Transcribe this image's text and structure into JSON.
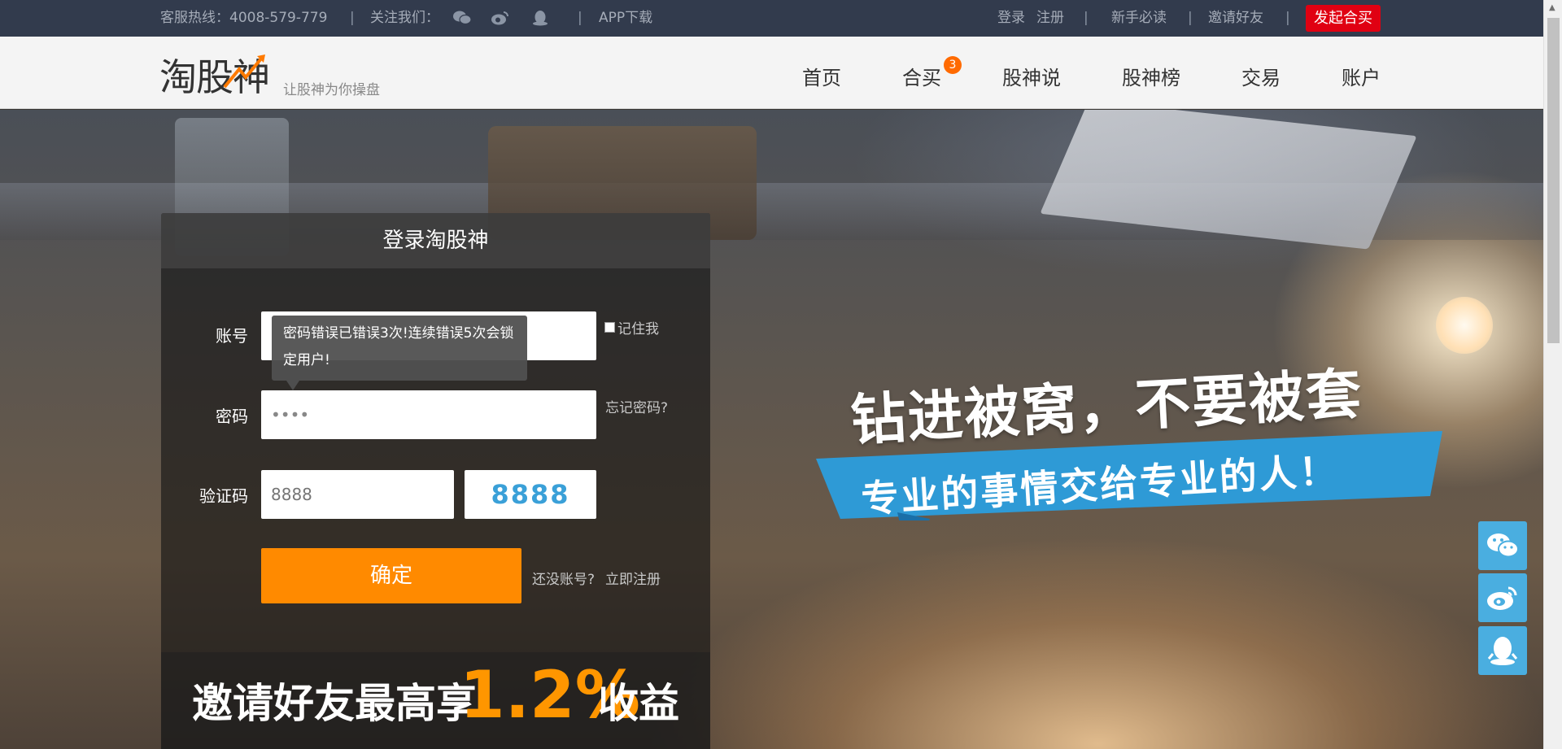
{
  "topbar": {
    "hotline": "客服热线：4008-579-779",
    "follow": "关注我们：",
    "app": "APP下载",
    "login": "登录",
    "register": "注册",
    "guide": "新手必读",
    "invite": "邀请好友",
    "launch": "发起合买",
    "separator": "|"
  },
  "header": {
    "logo": "淘股神",
    "tagline": "让股神为你操盘",
    "nav": [
      "首页",
      "合买",
      "股神说",
      "股神榜",
      "交易",
      "账户"
    ],
    "badge": "3"
  },
  "login": {
    "title": "登录淘股神",
    "account_label": "账号",
    "password_label": "密码",
    "password_value": "••••",
    "captcha_label": "验证码",
    "captcha_value": "8888",
    "captcha_image": "8888",
    "remember": "记住我",
    "forgot": "忘记密码?",
    "tooltip": "密码错误已错误3次!连续错误5次会锁定用户!",
    "submit": "确定",
    "no_account": "还没账号?",
    "register_now": "立即注册"
  },
  "invite_banner": {
    "text": "邀请好友最高享",
    "rate": "1.2%",
    "gain": "收益"
  },
  "hero": {
    "slogan": "钻进被窝，不要被套",
    "subslogan": "专业的事情交给专业的人！"
  },
  "side_buttons": [
    "wechat-icon",
    "weibo-icon",
    "qq-icon"
  ],
  "colors": {
    "topbar_bg": "#323b4d",
    "cta_red": "#e00012",
    "submit_orange": "#ff8a00",
    "ribbon_blue": "#2e9ad6",
    "float_blue": "#4aaee0"
  }
}
